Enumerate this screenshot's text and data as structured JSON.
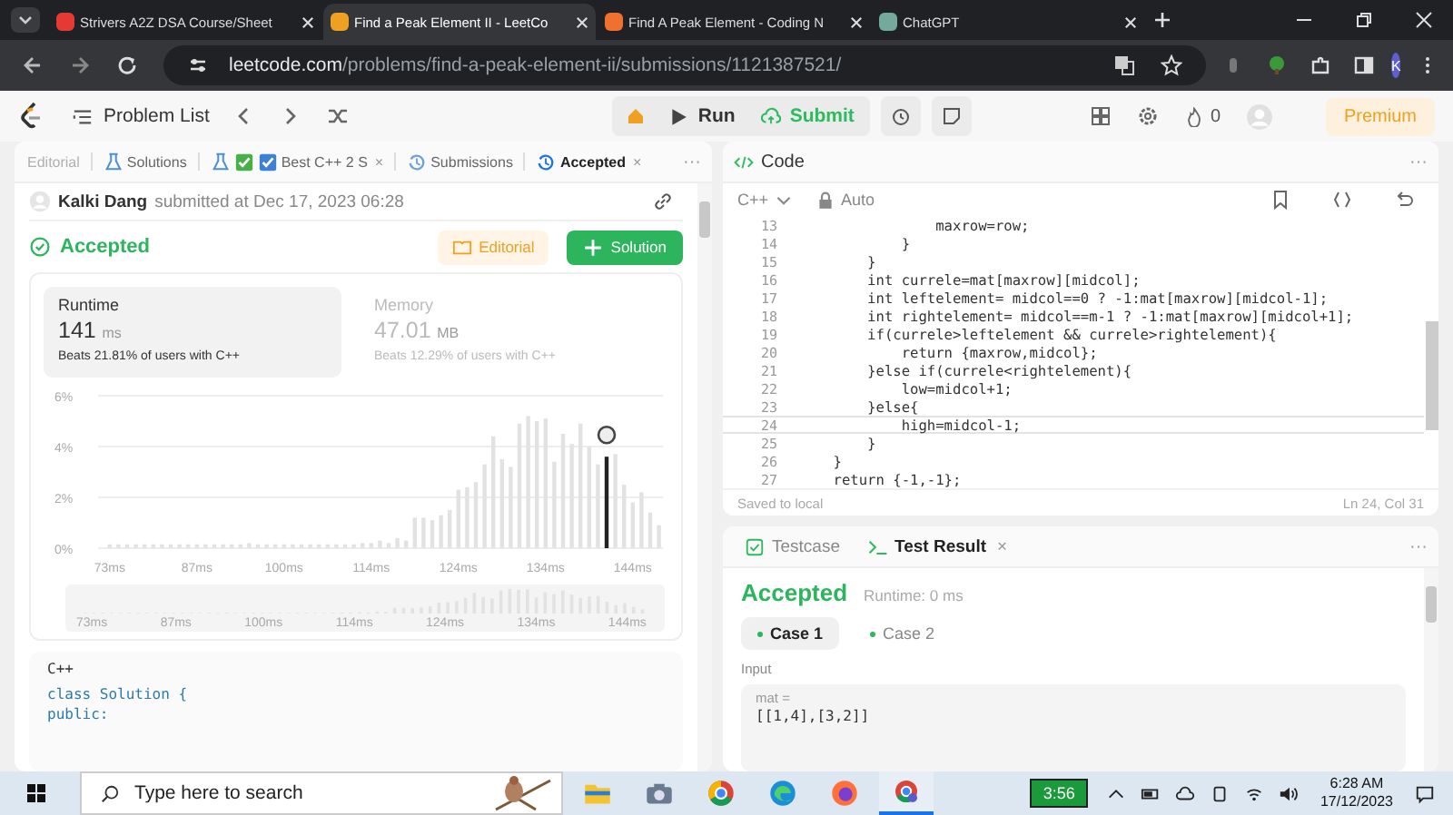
{
  "browser": {
    "tabs": [
      {
        "title": "Strivers A2Z DSA Course/Sheet",
        "selected": false,
        "color": "#e53935"
      },
      {
        "title": "Find a Peak Element II - LeetCo",
        "selected": true,
        "color": "#f0a020"
      },
      {
        "title": "Find A Peak Element - Coding N",
        "selected": false,
        "color": "#f07030"
      },
      {
        "title": "ChatGPT",
        "selected": false,
        "color": "#74aa9c"
      }
    ],
    "url_host": "leetcode.com",
    "url_path": "/problems/find-a-peak-element-ii/submissions/1121387521/",
    "profile": "K"
  },
  "topbar": {
    "problem_list": "Problem List",
    "run": "Run",
    "submit": "Submit",
    "streak": "0",
    "premium": "Premium"
  },
  "left": {
    "tabs": [
      {
        "label": "Editorial",
        "kind": "faded",
        "selected": false
      },
      {
        "label": "Solutions",
        "kind": "flask",
        "selected": false
      },
      {
        "label": "Best C++ 2 S",
        "kind": "post",
        "selected": false,
        "close": "×"
      },
      {
        "label": "Submissions",
        "kind": "history",
        "selected": false
      },
      {
        "label": "Accepted",
        "kind": "history",
        "selected": true,
        "close": "×"
      }
    ],
    "more": "···",
    "author": "Kalki Dang",
    "submitted": "submitted at Dec 17, 2023 06:28",
    "status": "Accepted",
    "editorial": "Editorial",
    "solution": "Solution",
    "runtime": {
      "label": "Runtime",
      "value": "141",
      "unit": "ms",
      "beats": "Beats 21.81% of users with C++",
      "selected": true
    },
    "memory": {
      "label": "Memory",
      "value": "47.01",
      "unit": "MB",
      "beats": "Beats 12.29% of users with C++",
      "selected": false
    },
    "chart_data": {
      "type": "bar",
      "stacked": true,
      "ylim": [
        0,
        6
      ],
      "yticks": [
        {
          "value": 0,
          "label": "0%"
        },
        {
          "value": 2,
          "label": "2%"
        },
        {
          "value": 4,
          "label": "4%"
        },
        {
          "value": 6,
          "label": "6%"
        }
      ],
      "categories": [
        "73ms",
        null,
        null,
        null,
        null,
        null,
        null,
        null,
        null,
        null,
        "87ms",
        null,
        null,
        null,
        null,
        null,
        null,
        null,
        null,
        null,
        "100ms",
        null,
        null,
        null,
        null,
        null,
        null,
        null,
        null,
        null,
        "114ms",
        null,
        null,
        null,
        null,
        null,
        null,
        null,
        null,
        null,
        "124ms",
        null,
        null,
        null,
        null,
        null,
        null,
        null,
        null,
        null,
        "134ms",
        null,
        null,
        null,
        null,
        null,
        null,
        null,
        null,
        null,
        "144ms",
        null,
        null,
        null
      ],
      "series": [
        {
          "color": "#e2e2e2",
          "values": [
            0.15,
            0.15,
            0.15,
            0.15,
            0.15,
            0.15,
            0.15,
            0.15,
            0.15,
            0.15,
            0.15,
            0.15,
            0.15,
            0.15,
            0.15,
            0.15,
            0.2,
            0.15,
            0.15,
            0.15,
            0.15,
            0.15,
            0.15,
            0.15,
            0.15,
            0.15,
            0.15,
            0.15,
            0.15,
            0.2,
            0.2,
            0.3,
            0.2,
            0.4,
            0.3,
            1.2,
            1.2,
            1.1,
            1.3,
            1.5,
            2.3,
            2.4,
            2.6,
            3.3,
            4.4,
            3.5,
            3.2,
            4.9,
            5.2,
            5.0,
            5.1,
            3.4,
            4.5,
            4.1,
            4.9,
            4.0,
            3.3,
            null,
            3.7,
            2.5,
            1.8,
            2.2,
            1.4,
            0.9
          ]
        },
        {
          "color": "#222222",
          "values": [
            null,
            null,
            null,
            null,
            null,
            null,
            null,
            null,
            null,
            null,
            null,
            null,
            null,
            null,
            null,
            null,
            null,
            null,
            null,
            null,
            null,
            null,
            null,
            null,
            null,
            null,
            null,
            null,
            null,
            null,
            null,
            null,
            null,
            null,
            null,
            null,
            null,
            null,
            null,
            null,
            null,
            null,
            null,
            null,
            null,
            null,
            null,
            null,
            null,
            null,
            null,
            null,
            null,
            null,
            null,
            null,
            null,
            3.6,
            null,
            null,
            null,
            null,
            null,
            null
          ]
        }
      ]
    },
    "overview_labels": [
      "73ms",
      "87ms",
      "100ms",
      "114ms",
      "124ms",
      "134ms",
      "144ms"
    ],
    "code_language": "C++",
    "code_lines": [
      "class Solution {",
      "public:"
    ]
  },
  "editor": {
    "title": "Code",
    "more": "···",
    "language": "C++",
    "mode": "Auto",
    "lines": [
      {
        "number": "13",
        "text": "                maxrow=row;",
        "selected": false
      },
      {
        "number": "14",
        "text": "            }",
        "selected": false
      },
      {
        "number": "15",
        "text": "        }",
        "selected": false
      },
      {
        "number": "16",
        "text": "        int currele=mat[maxrow][midcol];",
        "selected": false
      },
      {
        "number": "17",
        "text": "        int leftelement= midcol==0 ? -1:mat[maxrow][midcol-1];",
        "selected": false
      },
      {
        "number": "18",
        "text": "        int rightelement= midcol==m-1 ? -1:mat[maxrow][midcol+1];",
        "selected": false
      },
      {
        "number": "19",
        "text": "        if(currele>leftelement && currele>rightelement){",
        "selected": false
      },
      {
        "number": "20",
        "text": "            return {maxrow,midcol};",
        "selected": false
      },
      {
        "number": "21",
        "text": "        }else if(currele<rightelement){",
        "selected": false
      },
      {
        "number": "22",
        "text": "            low=midcol+1;",
        "selected": false
      },
      {
        "number": "23",
        "text": "        }else{",
        "selected": false
      },
      {
        "number": "24",
        "text": "            high=midcol-1;",
        "selected": true
      },
      {
        "number": "25",
        "text": "        }",
        "selected": false
      },
      {
        "number": "26",
        "text": "    }",
        "selected": false
      },
      {
        "number": "27",
        "text": "    return {-1,-1};",
        "selected": false
      }
    ],
    "saved": "Saved to local",
    "position": "Ln 24, Col 31"
  },
  "result": {
    "tabs": [
      {
        "label": "Testcase",
        "selected": false
      },
      {
        "label": "Test Result",
        "selected": true,
        "close": "×"
      }
    ],
    "more": "···",
    "status": "Accepted",
    "runtime": "Runtime: 0 ms",
    "cases": [
      {
        "label": "Case 1",
        "selected": true
      },
      {
        "label": "Case 2",
        "selected": false
      }
    ],
    "input_label": "Input",
    "var_name": "mat =",
    "var_value": "[[1,4],[3,2]]"
  },
  "taskbar": {
    "search_placeholder": "Type here to search",
    "battery": "3:56",
    "time": "6:28 AM",
    "date": "17/12/2023"
  }
}
